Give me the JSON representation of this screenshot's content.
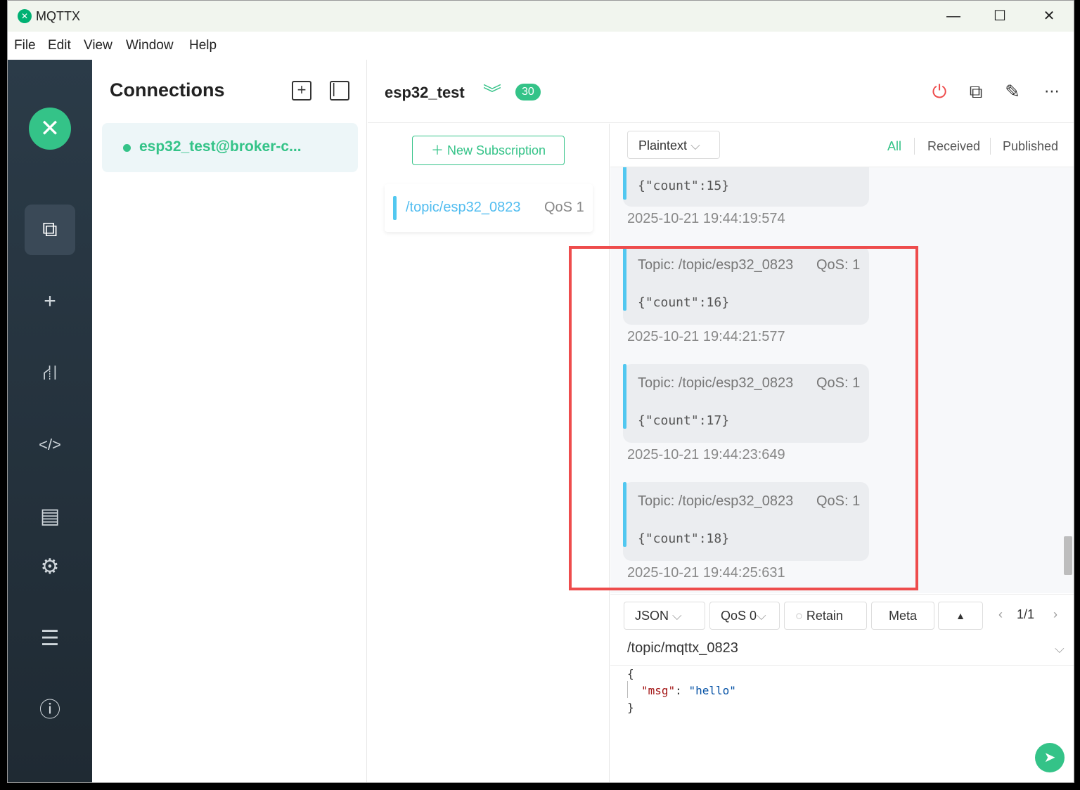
{
  "window": {
    "title": "MQTTX",
    "controls": {
      "minimize": "—",
      "maximize": "☐",
      "close": "✕"
    }
  },
  "menu": [
    "File",
    "Edit",
    "View",
    "Window",
    "Help"
  ],
  "left_nav": {
    "logo": "✕",
    "items": [
      {
        "name": "connections-icon",
        "glyph": "⧉"
      },
      {
        "name": "add-icon",
        "glyph": "+"
      },
      {
        "name": "topology-icon",
        "glyph": "⛙"
      },
      {
        "name": "code-icon",
        "glyph": "</>"
      },
      {
        "name": "log-icon",
        "glyph": "▤"
      },
      {
        "name": "settings-icon",
        "glyph": "⚙"
      },
      {
        "name": "feed-icon",
        "glyph": "☰"
      },
      {
        "name": "about-icon",
        "glyph": "ⓘ"
      }
    ]
  },
  "connections": {
    "title": "Connections",
    "items": [
      {
        "label": "esp32_test@broker-c...",
        "status_color": "#34c388"
      }
    ]
  },
  "header": {
    "title": "esp32_test",
    "count": "30",
    "accent": "#34c388"
  },
  "subscriptions": {
    "new_label": "New Subscription",
    "items": [
      {
        "topic": "/topic/esp32_0823",
        "qos": "QoS 1",
        "color": "#52c8f0"
      }
    ]
  },
  "messages": {
    "format": "Plaintext",
    "filters": [
      "All",
      "Received",
      "Published"
    ],
    "active_filter": "All",
    "items": [
      {
        "topic": "",
        "qos": "",
        "payload": "{\"count\":15}",
        "time": "2025-10-21 19:44:19:574"
      },
      {
        "topic": "Topic: /topic/esp32_0823",
        "qos": "QoS: 1",
        "payload": "{\"count\":16}",
        "time": "2025-10-21 19:44:21:577"
      },
      {
        "topic": "Topic: /topic/esp32_0823",
        "qos": "QoS: 1",
        "payload": "{\"count\":17}",
        "time": "2025-10-21 19:44:23:649"
      },
      {
        "topic": "Topic: /topic/esp32_0823",
        "qos": "QoS: 1",
        "payload": "{\"count\":18}",
        "time": "2025-10-21 19:44:25:631"
      }
    ]
  },
  "publish": {
    "format": "JSON",
    "qos": "QoS 0",
    "retain_label": "Retain",
    "meta_label": "Meta",
    "page": "1/1",
    "topic": "/topic/mqttx_0823",
    "payload_lines": [
      "{",
      "\"msg\": \"hello\"",
      "}"
    ],
    "key": "\"msg\"",
    "value": "\"hello\""
  }
}
